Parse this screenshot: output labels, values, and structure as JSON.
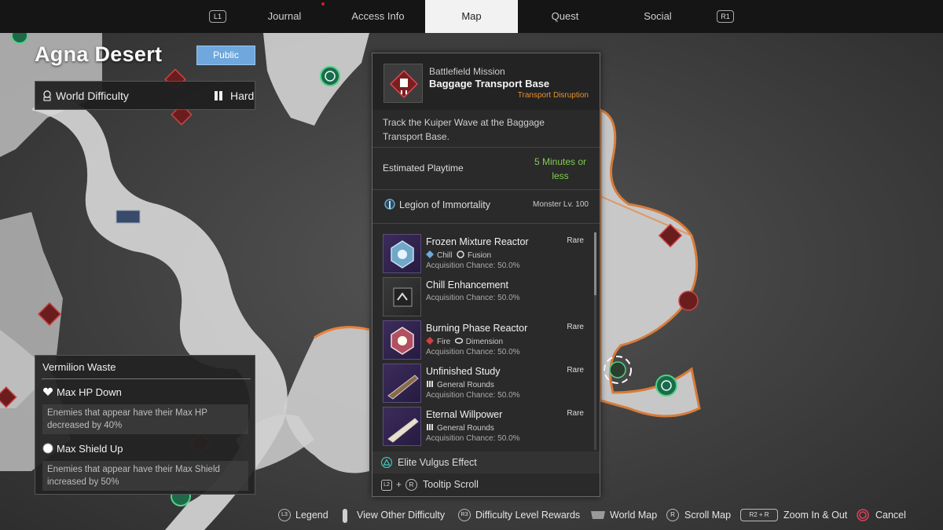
{
  "top_nav": {
    "left_button": "L1",
    "right_button": "R1",
    "tabs": [
      {
        "label": "Journal"
      },
      {
        "label": "Access Info"
      },
      {
        "label": "Map"
      },
      {
        "label": "Quest"
      },
      {
        "label": "Social"
      }
    ],
    "active_tab": "Map"
  },
  "region": {
    "title": "Agna Desert",
    "visibility": "Public"
  },
  "difficulty": {
    "label": "World Difficulty",
    "value": "Hard"
  },
  "modifiers": {
    "zone": "Vermilion Waste",
    "items": [
      {
        "name": "Max HP Down",
        "icon": "heart-icon",
        "desc": "Enemies that appear have their Max HP decreased by 40%"
      },
      {
        "name": "Max Shield Up",
        "icon": "shield-circle-icon",
        "desc": "Enemies that appear have their Max Shield increased by 50%"
      }
    ]
  },
  "tooltip": {
    "type": "Battlefield Mission",
    "name": "Baggage Transport Base",
    "subtype": "Transport Disruption",
    "subtype_color": "#e8922a",
    "description": "Track the Kuiper Wave at the Baggage Transport Base.",
    "playtime_label": "Estimated Playtime",
    "playtime_value": "5 Minutes or less",
    "playtime_color": "#7fcf4e",
    "faction": "Legion of Immortality",
    "monster_level": "Monster Lv. 100",
    "rewards": [
      {
        "name": "Frozen Mixture Reactor",
        "rarity": "Rare",
        "tags": [
          {
            "icon": "chill-icon",
            "text": "Chill"
          },
          {
            "icon": "fusion-icon",
            "text": "Fusion"
          }
        ],
        "chance": "Acquisition Chance: 50.0%"
      },
      {
        "name": "Chill Enhancement",
        "rarity": "",
        "tags": [],
        "chance": "Acquisition Chance: 50.0%"
      },
      {
        "name": "Burning Phase Reactor",
        "rarity": "Rare",
        "tags": [
          {
            "icon": "fire-icon",
            "text": "Fire"
          },
          {
            "icon": "dimension-icon",
            "text": "Dimension"
          }
        ],
        "chance": "Acquisition Chance: 50.0%"
      },
      {
        "name": "Unfinished Study",
        "rarity": "Rare",
        "tags": [
          {
            "icon": "general-rounds-icon",
            "text": "General Rounds"
          }
        ],
        "chance": "Acquisition Chance: 50.0%"
      },
      {
        "name": "Eternal Willpower",
        "rarity": "Rare",
        "tags": [
          {
            "icon": "general-rounds-icon",
            "text": "General Rounds"
          }
        ],
        "chance": "Acquisition Chance: 50.0%"
      }
    ],
    "footer_effect": "Elite Vulgus Effect",
    "footer_scroll": "Tooltip Scroll",
    "footer_scroll_buttons": [
      "L2",
      "+",
      "R"
    ]
  },
  "bottom_bar": [
    {
      "button": "L3",
      "label": "Legend"
    },
    {
      "button": "stick",
      "label": "View Other Difficulty"
    },
    {
      "button": "R3",
      "label": "Difficulty Level Rewards"
    },
    {
      "button": "touchpad",
      "label": "World Map"
    },
    {
      "button": "R",
      "label": "Scroll Map"
    },
    {
      "button": "R2 + R",
      "label": "Zoom In & Out"
    },
    {
      "button": "circle",
      "label": "Cancel"
    }
  ]
}
